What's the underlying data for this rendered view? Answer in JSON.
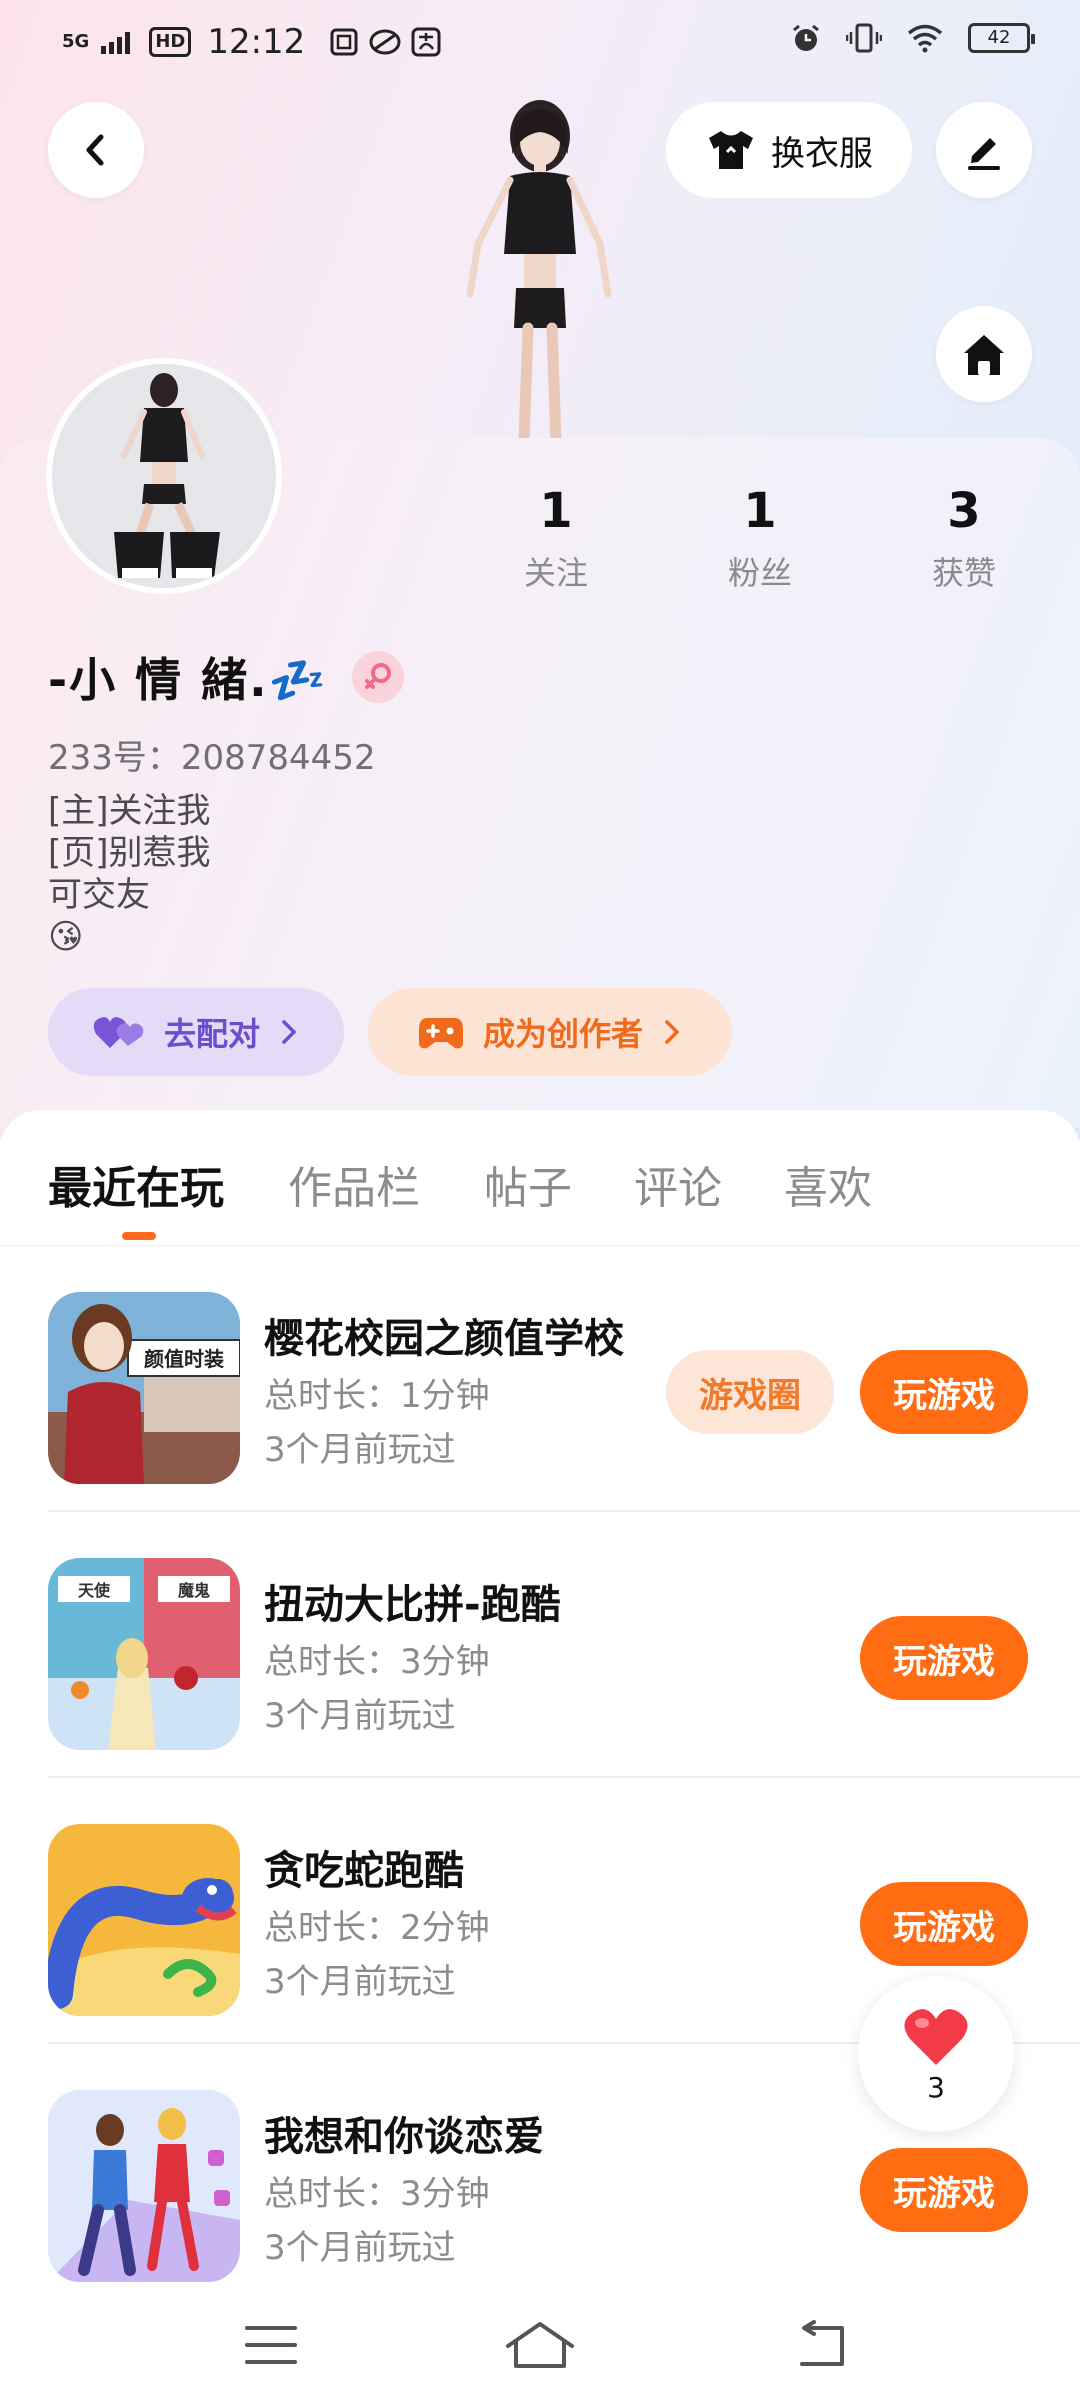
{
  "status_bar": {
    "network": "5G",
    "hd": "HD",
    "time": "12:12",
    "battery": "42"
  },
  "header": {
    "outfit_label": "换衣服"
  },
  "profile": {
    "stats": [
      {
        "value": "1",
        "label": "关注"
      },
      {
        "value": "1",
        "label": "粉丝"
      },
      {
        "value": "3",
        "label": "获赞"
      }
    ],
    "nickname": "-小 情 緒.💤",
    "uid": "233号：208784452",
    "bio": [
      "[主]关注我",
      "[页]别惹我",
      "可交友",
      "😘"
    ],
    "match_button": "去配对",
    "creator_button": "成为创作者"
  },
  "tabs": [
    {
      "label": "最近在玩",
      "active": true
    },
    {
      "label": "作品栏",
      "active": false
    },
    {
      "label": "帖子",
      "active": false
    },
    {
      "label": "评论",
      "active": false
    },
    {
      "label": "喜欢",
      "active": false
    }
  ],
  "games": [
    {
      "title": "樱花校园之颜值学校",
      "duration": "总时长：1分钟",
      "last_played": "3个月前玩过",
      "circle_label": "游戏圈",
      "play_label": "玩游戏",
      "icon_text": "颜值时装"
    },
    {
      "title": "扭动大比拼-跑酷",
      "duration": "总时长：3分钟",
      "last_played": "3个月前玩过",
      "play_label": "玩游戏",
      "icon_text_left": "天使",
      "icon_text_right": "魔鬼"
    },
    {
      "title": "贪吃蛇跑酷",
      "duration": "总时长：2分钟",
      "last_played": "3个月前玩过",
      "play_label": "玩游戏"
    },
    {
      "title": "我想和你谈恋爱",
      "duration": "总时长：3分钟",
      "last_played": "3个月前玩过",
      "play_label": "玩游戏"
    }
  ],
  "like_float": {
    "count": "3"
  },
  "colors": {
    "accent": "#ff6c12",
    "match_bg": "#e4dcf6",
    "match_fg": "#6c4ccf",
    "creator_bg": "#fde3d3",
    "creator_fg": "#f06a1c"
  }
}
